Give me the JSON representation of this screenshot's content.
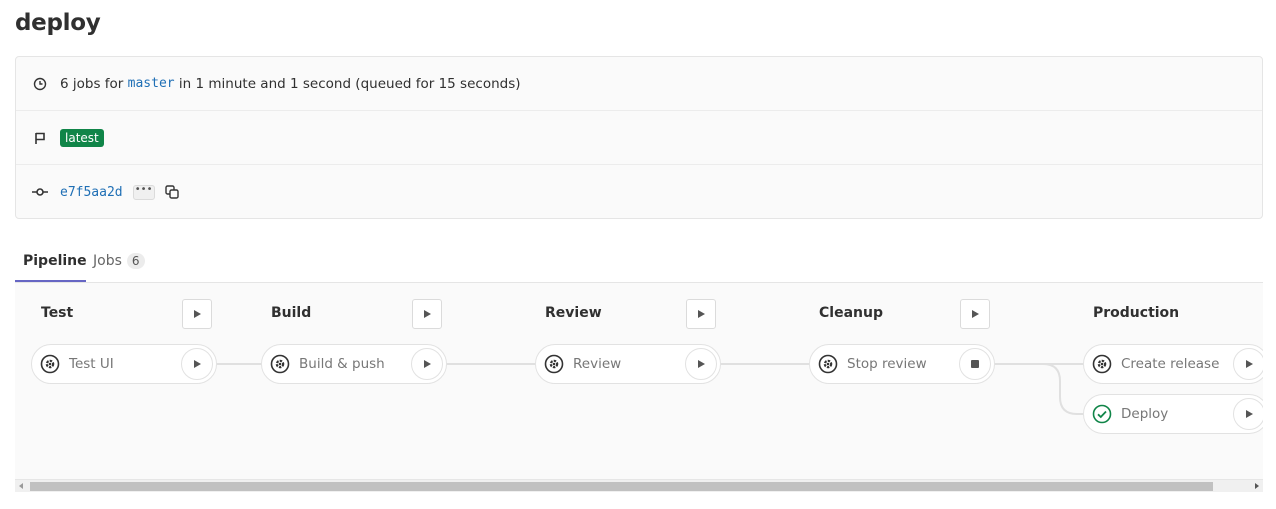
{
  "page": {
    "title": "deploy"
  },
  "info": {
    "jobs_prefix": "6 jobs for",
    "branch": "master",
    "duration": "in 1 minute and 1 second (queued for 15 seconds)",
    "tag": "latest",
    "commit": "e7f5aa2d",
    "ellipsis": "•••"
  },
  "tabs": {
    "pipeline": "Pipeline",
    "jobs": "Jobs",
    "jobs_count": "6"
  },
  "stages": [
    {
      "name": "Test",
      "jobs": [
        {
          "label": "Test UI",
          "status_icon": "gear-icon",
          "action_icon": "play-icon"
        }
      ]
    },
    {
      "name": "Build",
      "jobs": [
        {
          "label": "Build & push",
          "status_icon": "gear-icon",
          "action_icon": "play-icon"
        }
      ]
    },
    {
      "name": "Review",
      "jobs": [
        {
          "label": "Review",
          "status_icon": "gear-icon",
          "action_icon": "play-icon"
        }
      ]
    },
    {
      "name": "Cleanup",
      "jobs": [
        {
          "label": "Stop review",
          "status_icon": "gear-icon",
          "action_icon": "stop-icon"
        }
      ]
    },
    {
      "name": "Production",
      "jobs": [
        {
          "label": "Create release",
          "status_icon": "gear-icon",
          "action_icon": "play-icon"
        },
        {
          "label": "Deploy",
          "status_icon": "check-circle-icon",
          "action_icon": "play-icon"
        }
      ]
    }
  ],
  "colors": {
    "success": "#108548",
    "link": "#1f6fb5",
    "tab_underline": "#6666c4"
  }
}
